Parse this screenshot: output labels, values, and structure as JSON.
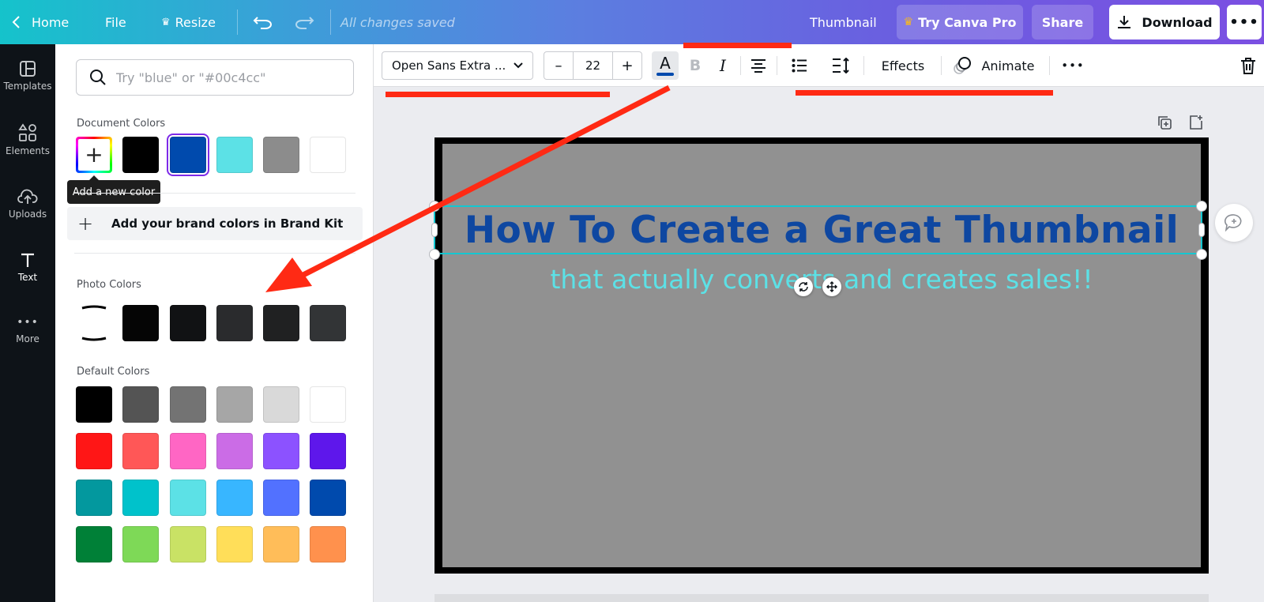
{
  "topbar": {
    "home_label": "Home",
    "file_label": "File",
    "resize_label": "Resize",
    "saved_status": "All changes saved",
    "doc_title": "Thumbnail",
    "pro_label": "Try Canva Pro",
    "share_label": "Share",
    "download_label": "Download",
    "more_icon": "more-horizontal-icon"
  },
  "rail": {
    "items": [
      {
        "label": "Templates",
        "icon": "templates-icon"
      },
      {
        "label": "Elements",
        "icon": "elements-icon"
      },
      {
        "label": "Uploads",
        "icon": "upload-icon"
      },
      {
        "label": "Text",
        "icon": "text-icon",
        "active": true
      },
      {
        "label": "More",
        "icon": "more-horizontal-icon"
      }
    ]
  },
  "panel": {
    "search_placeholder": "Try \"blue\" or \"#00c4cc\"",
    "document_colors_title": "Document Colors",
    "document_colors": [
      "#000000",
      "#004aad",
      "#5ce1e6",
      "#8c8c8c",
      "#ffffff"
    ],
    "selected_document_color": "#004aad",
    "tooltip": "Add a new color",
    "brand_kit_label": "Add your brand colors in Brand Kit",
    "photo_colors_title": "Photo Colors",
    "photo_colors": [
      "#050505",
      "#111214",
      "#2a2b2d",
      "#202122",
      "#323436"
    ],
    "default_colors_title": "Default Colors",
    "default_colors": [
      [
        "#000000",
        "#545454",
        "#737373",
        "#a6a6a6",
        "#d9d9d9",
        "#ffffff"
      ],
      [
        "#ff1616",
        "#ff5757",
        "#ff66c4",
        "#cb6ce6",
        "#8c52ff",
        "#5e17eb"
      ],
      [
        "#03989e",
        "#00c2cb",
        "#5ce1e6",
        "#38b6ff",
        "#5271ff",
        "#004aad"
      ],
      [
        "#008037",
        "#7ed957",
        "#c9e265",
        "#ffde59",
        "#ffbd59",
        "#ff914d"
      ]
    ]
  },
  "toolbar": {
    "font_name": "Open Sans Extra ...",
    "font_size": "22",
    "decrease_label": "–",
    "increase_label": "+",
    "text_color_letter": "A",
    "text_color": "#004aad",
    "bold_letter": "B",
    "italic_letter": "I",
    "effects_label": "Effects",
    "animate_label": "Animate"
  },
  "canvas": {
    "headline": "How To Create a Great Thumbnail",
    "subline": "that actually converts and creates sales!!",
    "background": "#919191",
    "headline_color": "#0e47a1",
    "subline_color": "#5ce1e6"
  },
  "annotations": {
    "color": "#ff2a14"
  }
}
